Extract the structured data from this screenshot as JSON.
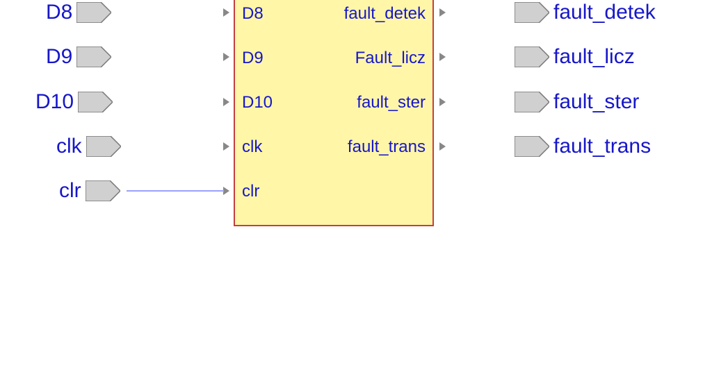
{
  "inputs": [
    {
      "label": "D8"
    },
    {
      "label": "D9"
    },
    {
      "label": "D10"
    },
    {
      "label": "clk"
    },
    {
      "label": "clr"
    }
  ],
  "outputs": [
    {
      "label": "fault_detek"
    },
    {
      "label": "fault_licz"
    },
    {
      "label": "fault_ster"
    },
    {
      "label": "fault_trans"
    }
  ],
  "component": {
    "left_pins": [
      {
        "label": "D8"
      },
      {
        "label": "D9"
      },
      {
        "label": "D10"
      },
      {
        "label": "clk"
      },
      {
        "label": "clr"
      }
    ],
    "right_pins": [
      {
        "label": "fault_detek"
      },
      {
        "label": "Fault_licz"
      },
      {
        "label": "fault_ster"
      },
      {
        "label": "fault_trans"
      }
    ]
  }
}
